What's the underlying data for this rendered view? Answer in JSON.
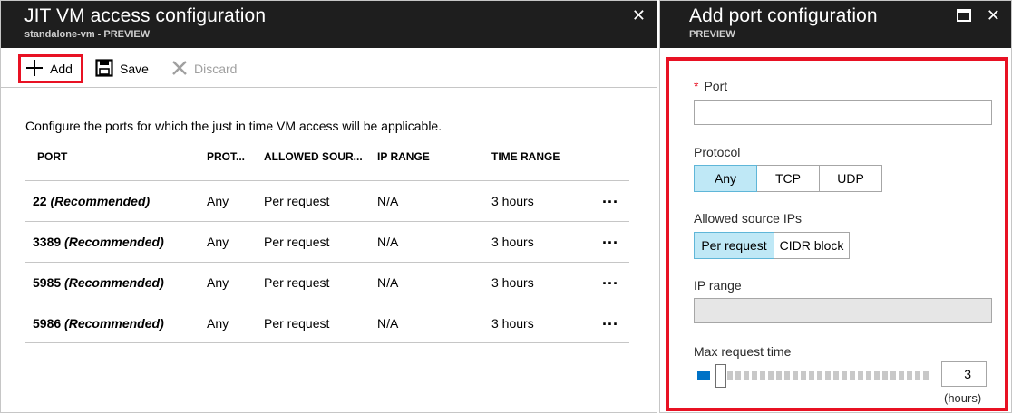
{
  "left_blade": {
    "title": "JIT VM access configuration",
    "subtitle": "standalone-vm - PREVIEW",
    "close_glyph": "✕",
    "toolbar": {
      "add_label": "Add",
      "save_label": "Save",
      "discard_label": "Discard"
    },
    "description": "Configure the ports for which the just in time VM access will be applicable.",
    "columns": [
      "PORT",
      "PROT...",
      "ALLOWED SOUR...",
      "IP RANGE",
      "TIME RANGE"
    ],
    "rows": [
      {
        "port": "22",
        "note": "(Recommended)",
        "protocol": "Any",
        "allowed_source": "Per request",
        "ip_range": "N/A",
        "time_range": "3 hours"
      },
      {
        "port": "3389",
        "note": "(Recommended)",
        "protocol": "Any",
        "allowed_source": "Per request",
        "ip_range": "N/A",
        "time_range": "3 hours"
      },
      {
        "port": "5985",
        "note": "(Recommended)",
        "protocol": "Any",
        "allowed_source": "Per request",
        "ip_range": "N/A",
        "time_range": "3 hours"
      },
      {
        "port": "5986",
        "note": "(Recommended)",
        "protocol": "Any",
        "allowed_source": "Per request",
        "ip_range": "N/A",
        "time_range": "3 hours"
      }
    ],
    "more_glyph": "..."
  },
  "right_blade": {
    "title": "Add port configuration",
    "subtitle": "PREVIEW",
    "maximize_glyph": "▭",
    "close_glyph": "✕",
    "port": {
      "required_mark": "*",
      "label": "Port",
      "value": ""
    },
    "protocol": {
      "label": "Protocol",
      "options": [
        "Any",
        "TCP",
        "UDP"
      ],
      "selected": "Any"
    },
    "allowed_source": {
      "label": "Allowed source IPs",
      "options": [
        "Per request",
        "CIDR block"
      ],
      "selected": "Per request"
    },
    "ip_range": {
      "label": "IP range",
      "value": ""
    },
    "max_request_time": {
      "label": "Max request time",
      "value": "3",
      "unit": "(hours)",
      "min": 1,
      "max": 24,
      "level": 3
    }
  },
  "colors": {
    "header_bg": "#1e1e1e",
    "highlight_border": "#e81123",
    "selected_option": "#bfe8f6",
    "slider_fill": "#0072c6"
  }
}
